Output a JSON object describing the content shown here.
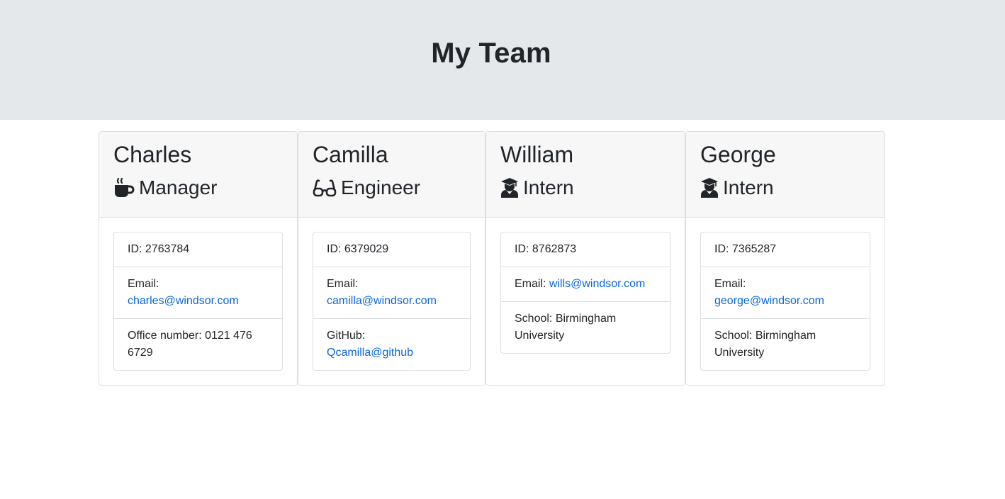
{
  "header": {
    "title": "My Team"
  },
  "members": [
    {
      "name": "Charles",
      "role": "Manager",
      "icon": "mug-icon",
      "id_text": "ID: 2763784",
      "email_label": "Email:",
      "email": "charles@windsor.com",
      "extra_text": "Office number: 0121 476 6729"
    },
    {
      "name": "Camilla",
      "role": "Engineer",
      "icon": "glasses-icon",
      "id_text": "ID: 6379029",
      "email_label": "Email:",
      "email": "camilla@windsor.com",
      "extra_label": "GitHub:",
      "extra_link": "Qcamilla@github"
    },
    {
      "name": "William",
      "role": "Intern",
      "icon": "graduate-icon",
      "id_text": "ID: 8762873",
      "email_label": "Email:",
      "email": "wills@windsor.com",
      "extra_text": "School: Birmingham University"
    },
    {
      "name": "George",
      "role": "Intern",
      "icon": "graduate-icon",
      "id_text": "ID: 7365287",
      "email_label": "Email:",
      "email": "george@windsor.com",
      "extra_text": "School: Birmingham University"
    }
  ]
}
